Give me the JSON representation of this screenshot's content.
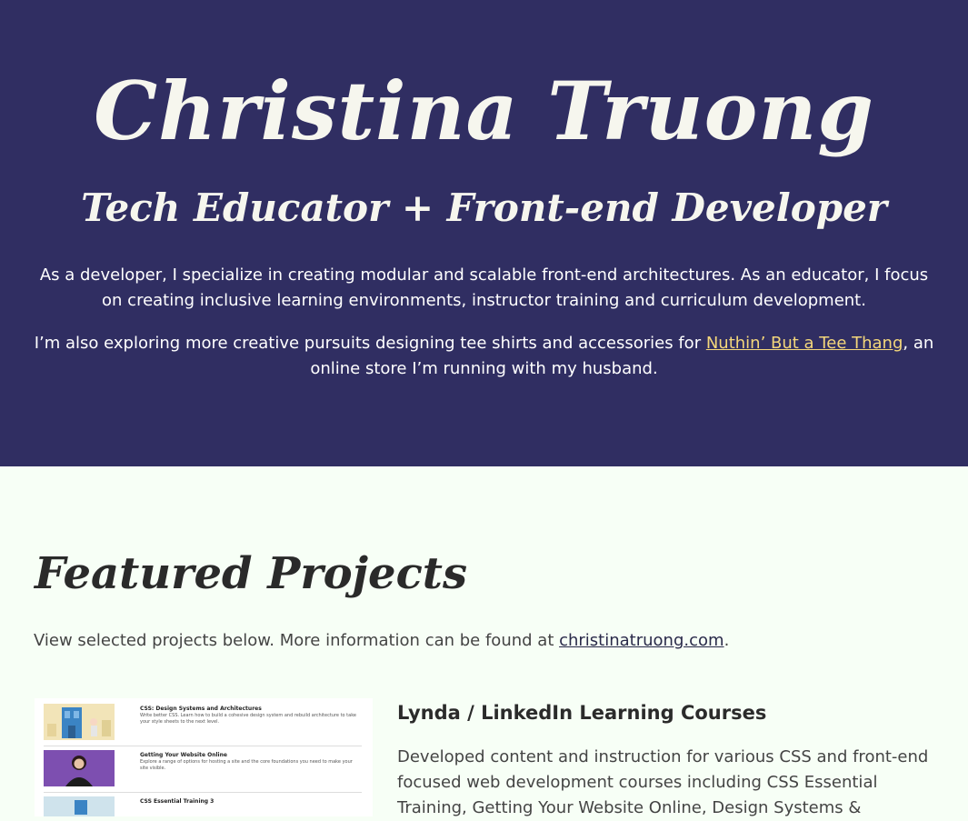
{
  "hero": {
    "name": "Christina Truong",
    "tagline": "Tech Educator + Front-end Developer",
    "paragraph1": "As a developer, I specialize in creating modular and scalable front-end architectures. As an educator, I focus on creating inclusive learning environments, instructor training and curriculum development.",
    "paragraph2_before": "I’m also exploring more creative pursuits designing tee shirts and accessories for ",
    "paragraph2_link": "Nuthin’ But a Tee Thang",
    "paragraph2_after": ", an online store I’m running with my husband."
  },
  "featured": {
    "title": "Featured Projects",
    "intro_before": "View selected projects below. More information can be found at ",
    "intro_link": "christinatruong.com",
    "intro_after": ".",
    "projects": [
      {
        "title": "Lynda / LinkedIn Learning Courses",
        "description": "Developed content and instruction for various CSS and front-end focused web development courses including CSS Essential Training, Getting Your Website Online, Design Systems &",
        "thumbnail_courses": [
          {
            "title": "CSS: Design Systems and Architectures",
            "desc": "Write better CSS. Learn how to build a cohesive design system and rebuild architecture to take your style sheets to the next level."
          },
          {
            "title": "Getting Your Website Online",
            "desc": "Explore a range of options for hosting a site and the core foundations you need to make your site visible."
          },
          {
            "title": "CSS Essential Training 3",
            "desc": ""
          }
        ]
      }
    ]
  },
  "colors": {
    "hero_bg": "#302e62",
    "body_bg": "#f7fff6",
    "link_highlight": "#f4d77b"
  }
}
